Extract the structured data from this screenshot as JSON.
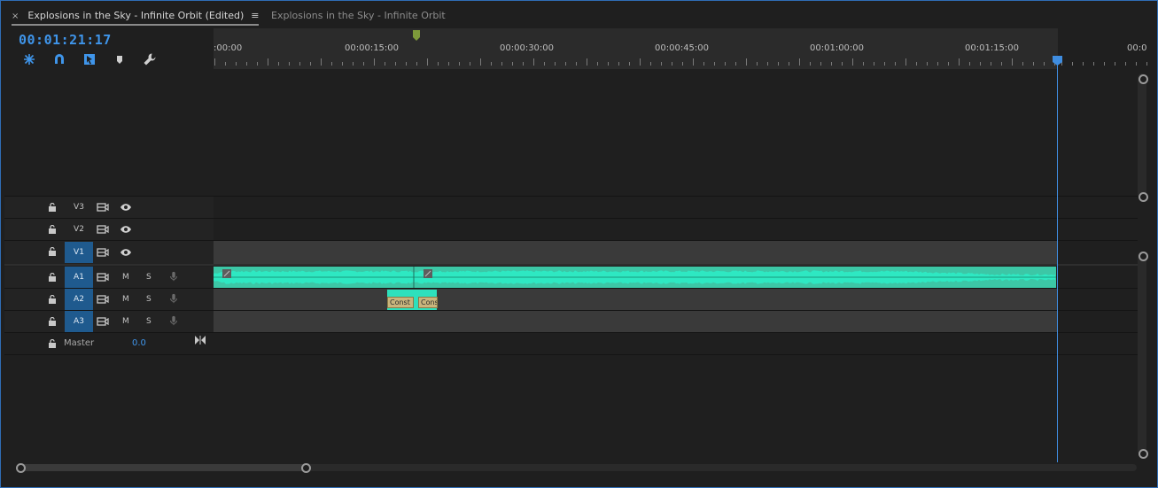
{
  "tabs": [
    {
      "label": "Explosions in the Sky - Infinite Orbit (Edited)",
      "active": true
    },
    {
      "label": "Explosions in the Sky - Infinite Orbit",
      "active": false
    }
  ],
  "tab_close": "×",
  "tab_menu": "≡",
  "timecode": "00:01:21:17",
  "tools": [
    "snap-nest-icon",
    "magnet-icon",
    "linked-selection-icon",
    "marker-icon",
    "wrench-icon"
  ],
  "ruler": {
    "labels": [
      ":00:00",
      "00:00:15:00",
      "00:00:30:00",
      "00:00:45:00",
      "00:01:00:00",
      "00:01:15:00",
      "00:0"
    ],
    "playhead_position": "00:01:21:17"
  },
  "tracks": {
    "video": [
      {
        "label": "V3",
        "targeted": false
      },
      {
        "label": "V2",
        "targeted": false
      },
      {
        "label": "V1",
        "targeted": true
      }
    ],
    "audio": [
      {
        "label": "A1",
        "targeted": true,
        "m": "M",
        "s": "S"
      },
      {
        "label": "A2",
        "targeted": true,
        "m": "M",
        "s": "S"
      },
      {
        "label": "A3",
        "targeted": true,
        "m": "M",
        "s": "S"
      }
    ],
    "master": {
      "label": "Master",
      "value": "0.0"
    }
  },
  "clips": {
    "a2_labels": [
      "Const",
      "Cons"
    ]
  },
  "colors": {
    "accent": "#3f95ea",
    "audio_clip": "#3cc7a6",
    "waveform": "#2ee8c2",
    "transition": "#c9b57d"
  }
}
